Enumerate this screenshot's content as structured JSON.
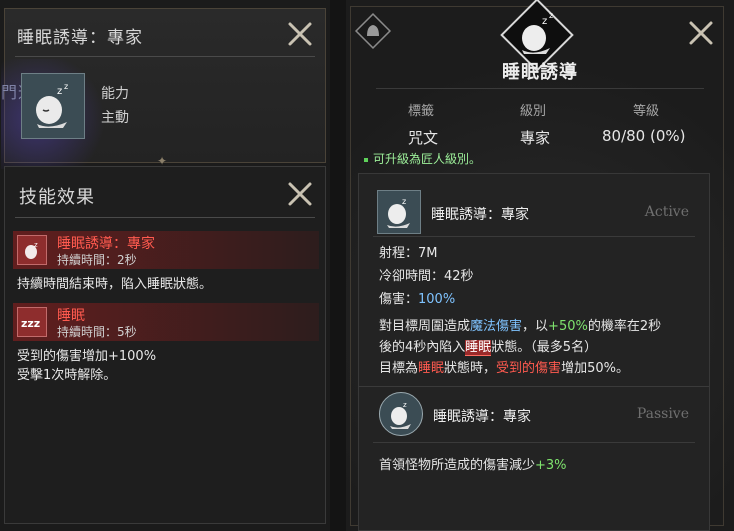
{
  "left": {
    "item_title": "睡眠誘導：專家",
    "tag": "門道具",
    "ability_label": "能力",
    "ability_type": "主動",
    "effects_title": "技能效果",
    "effects": [
      {
        "name": "睡眠誘導：專家",
        "duration": "持續時間：2秒",
        "description": "持續時間結束時，陷入睡眠狀態。"
      },
      {
        "name": "睡眠",
        "duration": "持續時間：5秒",
        "description_lines": [
          "受到的傷害增加+100%",
          "受擊1次時解除。"
        ]
      }
    ]
  },
  "right": {
    "title": "睡眠誘導",
    "columns": [
      {
        "header": "標籤",
        "value": "咒文"
      },
      {
        "header": "級別",
        "value": "專家"
      },
      {
        "header": "等級",
        "value": "80/80 (0%)"
      }
    ],
    "upgrade_note": "可升級為匠人級別。",
    "active": {
      "name": "睡眠誘導：專家",
      "mode": "Active",
      "range": "射程：7M",
      "cooldown": "冷卻時間：42秒",
      "damage_label": "傷害：",
      "damage_value": "100%",
      "desc": {
        "l1_a": "對目標周圍造成",
        "l1_magic": "魔法傷害",
        "l1_b": "，以",
        "l1_pct": "+50%",
        "l1_c": "的機率在2秒",
        "l2_a": "後的4秒內陷入",
        "l2_sleep": "睡眠",
        "l2_b": "狀態。（最多5名）",
        "l3_a": "目標為",
        "l3_sleep": "睡眠",
        "l3_b": "狀態時，",
        "l3_dmg": "受到的傷害",
        "l3_c": "增加50%。"
      }
    },
    "passive": {
      "name": "睡眠誘導：專家",
      "mode": "Passive",
      "desc_a": "首領怪物所造成的傷害減少",
      "desc_pct": "+3%"
    }
  },
  "icons": {
    "close": "close-x-icon",
    "skill": "sleeping-head-icon",
    "effect_skill": "sleep-induce-icon",
    "effect_sleep": "zzz-icon",
    "corner": "bell-diamond-icon"
  },
  "colors": {
    "accent_red": "#ff5a4f",
    "accent_green": "#7fe46e",
    "accent_blue": "#7fc3ff"
  }
}
